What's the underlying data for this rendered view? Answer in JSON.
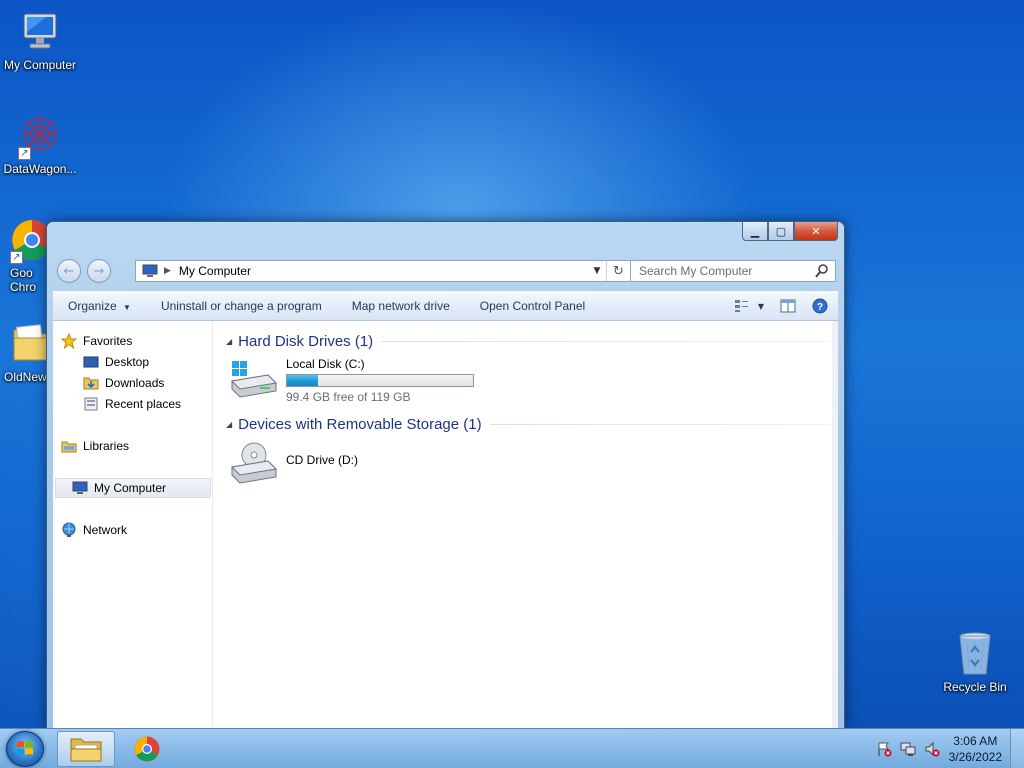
{
  "desktop": {
    "icons": {
      "my_computer": "My Computer",
      "datawagon": "DataWagon...",
      "chrome_line1": "Goo",
      "chrome_line2": "Chro",
      "oldnew": "OldNew",
      "recycle_bin": "Recycle Bin"
    }
  },
  "window": {
    "address": "My Computer",
    "search_placeholder": "Search My Computer",
    "toolbar": {
      "organize": "Organize",
      "uninstall": "Uninstall or change a program",
      "map_drive": "Map network drive",
      "control_panel": "Open Control Panel"
    },
    "nav": {
      "favorites": "Favorites",
      "desktop": "Desktop",
      "downloads": "Downloads",
      "recent": "Recent places",
      "libraries": "Libraries",
      "my_computer": "My Computer",
      "network": "Network"
    },
    "groups": {
      "hdd": "Hard Disk Drives (1)",
      "removable": "Devices with Removable Storage (1)"
    },
    "drives": {
      "c_name": "Local Disk (C:)",
      "c_free": "99.4 GB free of 119 GB",
      "c_used_fraction": 0.165,
      "d_name": "CD Drive (D:)"
    }
  },
  "taskbar": {
    "time": "3:06 AM",
    "date": "3/26/2022"
  },
  "colors": {
    "accent": "#1f9ad6",
    "group_header": "#1e3287"
  }
}
